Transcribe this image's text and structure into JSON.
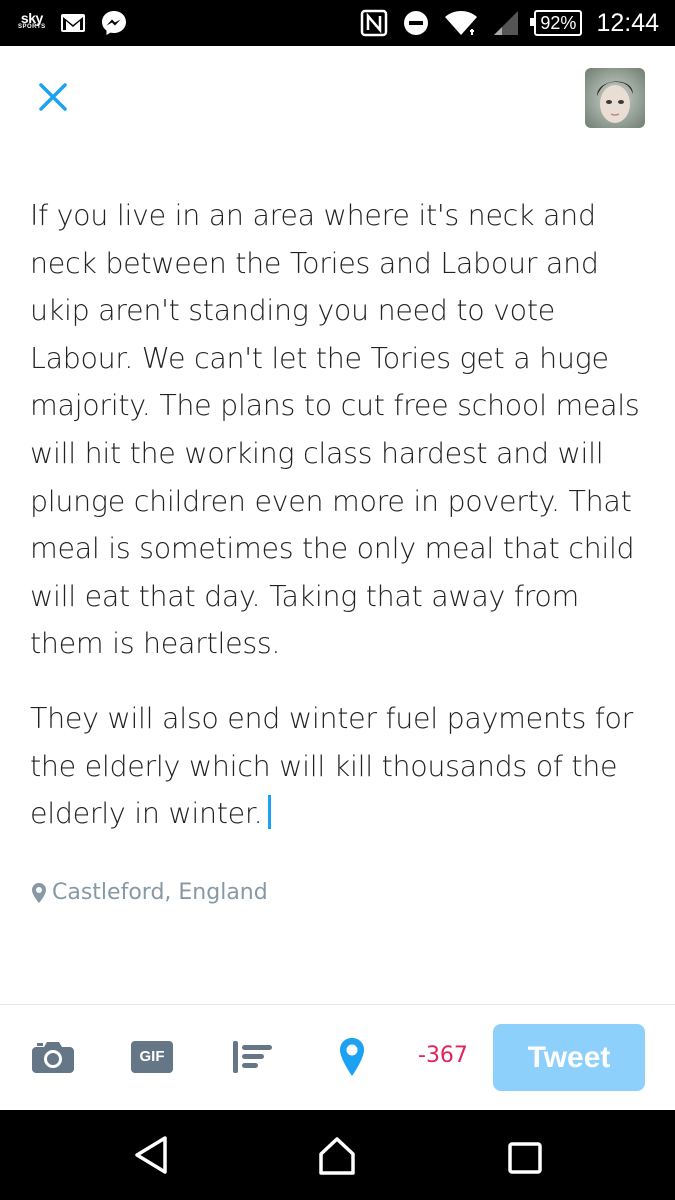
{
  "status_bar": {
    "sky_logo": {
      "top": "sky",
      "bottom": "SPORTS"
    },
    "icons": [
      "gmail-icon",
      "messenger-icon",
      "nfc-icon",
      "do-not-disturb-icon",
      "wifi-icon",
      "signal-icon"
    ],
    "battery": "92%",
    "time": "12:44"
  },
  "compose": {
    "close_icon": "close-icon",
    "avatar": "user-avatar",
    "paragraphs": [
      "If you live in an area where it's neck and neck between the Tories and Labour and ukip aren't standing you need to vote Labour. We can't let the Tories get a huge majority. The plans to cut free school meals will hit the working class hardest and will plunge children even more in poverty. That meal is sometimes the only meal that child will eat that day. Taking that away from them is heartless.",
      "They will also end winter fuel payments for the elderly which will kill thousands of the elderly in winter."
    ],
    "location": "Castleford, England"
  },
  "toolbar": {
    "icons": [
      "camera-icon",
      "gif-icon",
      "poll-icon",
      "location-pin-icon"
    ],
    "gif_label": "GIF",
    "char_counter": "-367",
    "tweet_label": "Tweet",
    "accent_color": "#1da1f2",
    "counter_color": "#e0245e",
    "tweet_button_color": "#8dd0fb"
  },
  "nav_bar": {
    "icons": [
      "back-icon",
      "home-icon",
      "recents-icon"
    ]
  }
}
